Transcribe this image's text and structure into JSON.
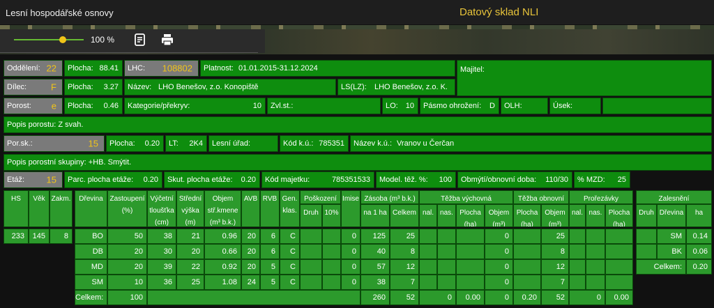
{
  "header": {
    "app_title": "Lesní hospodářské osnovy",
    "nli_title": "Datový sklad NLI"
  },
  "toolbar": {
    "zoom_percent": "100 %",
    "zoom_level": 100
  },
  "row1": {
    "oddeleni_label": "Oddělení:",
    "oddeleni_value": "22",
    "plocha_label": "Plocha:",
    "plocha_value": "88.41",
    "lhc_label": "LHC:",
    "lhc_value": "108802",
    "platnost_label": "Platnost:",
    "platnost_value": "01.01.2015-31.12.2024",
    "majitel_label": "Majitel:"
  },
  "row2": {
    "dilec_label": "Dílec:",
    "dilec_value": "F",
    "plocha_label": "Plocha:",
    "plocha_value": "3.27",
    "nazev_label": "Název:",
    "nazev_value": "LHO Benešov, z.o. Konopiště",
    "lslz_label": "LS(LZ):",
    "lslz_value": "LHO Benešov, z.o. K."
  },
  "row3": {
    "porost_label": "Porost:",
    "porost_value": "e",
    "plocha_label": "Plocha:",
    "plocha_value": "0.46",
    "kategorie_label": "Kategorie/překryv:",
    "kategorie_value": "10",
    "zvlst_label": "Zvl.st.:",
    "lo_label": "LO:",
    "lo_value": "10",
    "pasmo_label": "Pásmo ohrožení:",
    "pasmo_value": "D",
    "olh_label": "OLH:",
    "usek_label": "Úsek:"
  },
  "popis_porostu": "Popis porostu: Z svah.",
  "row5": {
    "porsk_label": "Por.sk.:",
    "porsk_value": "15",
    "plocha_label": "Plocha:",
    "plocha_value": "0.20",
    "lt_label": "LT:",
    "lt_value": "2K4",
    "lesni_urad_label": "Lesní úřad:",
    "kod_ku_label": "Kód k.ú.:",
    "kod_ku_value": "785351",
    "nazev_ku_label": "Název k.ú.:",
    "nazev_ku_value": "Vranov u Čerčan"
  },
  "popis_skupiny": "Popis porostní skupiny: +HB. Smýtit.",
  "row7": {
    "etaz_label": "Etáž:",
    "etaz_value": "15",
    "parc_label": "Parc. plocha etáže:",
    "parc_value": "0.20",
    "skut_label": "Skut. plocha etáže:",
    "skut_value": "0.20",
    "kod_majetku_label": "Kód majetku:",
    "kod_majetku_value": "785351533",
    "model_label": "Model. těž. %:",
    "model_value": "100",
    "obmyti_label": "Obmýtí/obnovní doba:",
    "obmyti_value": "110/30",
    "mzd_label": "% MZD:",
    "mzd_value": "25"
  },
  "left_table": {
    "headers": [
      "HS",
      "Věk",
      "Zakm."
    ],
    "values": [
      "233",
      "145",
      "8"
    ]
  },
  "main_table": {
    "headers": {
      "drevina": "Dřevina",
      "zastoupeni": "Zastoupení (%)",
      "vycetni": "Výčetní tloušťka (cm)",
      "stredni": "Střední výška (m)",
      "objem": "Objem stř.kmene (m³ b.k.)",
      "avb": "AVB",
      "rvb": "RVB",
      "gen": "Gen. klas.",
      "poskozeni": "Poškození",
      "druh": "Druh",
      "p10": "10%",
      "imise": "Imise",
      "zasoba": "Zásoba (m³ b.k.)",
      "na1ha": "na 1 ha",
      "celkem": "Celkem",
      "tezba_vych": "Těžba výchovná",
      "nal": "nal.",
      "nas": "nas.",
      "plocha_ha": "Plocha (ha)",
      "objem_m3": "Objem (m³)",
      "tezba_obn": "Těžba obnovní",
      "prorezavky": "Prořezávky"
    },
    "rows": [
      {
        "drevina": "BO",
        "zast": "50",
        "tl": "38",
        "vys": "21",
        "obj": "0.96",
        "avb": "20",
        "rvb": "6",
        "gen": "C",
        "imise": "0",
        "na1ha": "125",
        "celkem": "25",
        "tv_obj": "0",
        "to_obj": "25"
      },
      {
        "drevina": "DB",
        "zast": "20",
        "tl": "30",
        "vys": "20",
        "obj": "0.66",
        "avb": "20",
        "rvb": "6",
        "gen": "C",
        "imise": "0",
        "na1ha": "40",
        "celkem": "8",
        "tv_obj": "0",
        "to_obj": "8"
      },
      {
        "drevina": "MD",
        "zast": "20",
        "tl": "39",
        "vys": "22",
        "obj": "0.92",
        "avb": "20",
        "rvb": "5",
        "gen": "C",
        "imise": "0",
        "na1ha": "57",
        "celkem": "12",
        "tv_obj": "0",
        "to_obj": "12"
      },
      {
        "drevina": "SM",
        "zast": "10",
        "tl": "36",
        "vys": "25",
        "obj": "1.08",
        "avb": "24",
        "rvb": "5",
        "gen": "C",
        "imise": "0",
        "na1ha": "38",
        "celkem": "7",
        "tv_obj": "0",
        "to_obj": "7"
      }
    ],
    "total": {
      "label": "Celkem:",
      "zast": "100",
      "na1ha": "260",
      "celkem": "52",
      "tv_nal": "0",
      "tv_plocha": "0.00",
      "tv_obj": "0",
      "to_plocha": "0.20",
      "to_obj": "52",
      "pr_nal": "0",
      "pr_plocha": "0.00"
    }
  },
  "zalesneni": {
    "title": "Zalesnění",
    "druh": "Druh",
    "drevina": "Dřevina",
    "ha": "ha",
    "rows": [
      {
        "drevina": "SM",
        "ha": "0.14"
      },
      {
        "drevina": "BK",
        "ha": "0.06"
      }
    ],
    "total_label": "Celkem:",
    "total_value": "0.20"
  }
}
